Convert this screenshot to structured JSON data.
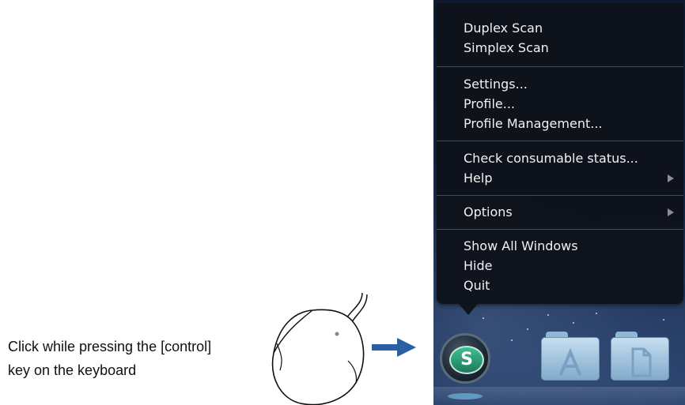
{
  "instruction": {
    "line1": "Click while pressing the [control]",
    "line2": "key on the keyboard"
  },
  "menu": {
    "groups": [
      [
        "Duplex Scan",
        "Simplex Scan"
      ],
      [
        "Settings...",
        "Profile...",
        "Profile Management..."
      ],
      [
        "Check consumable status...",
        "Help"
      ],
      [
        "Options"
      ],
      [
        "Show All Windows",
        "Hide",
        "Quit"
      ]
    ],
    "submenu_items": [
      "Help",
      "Options"
    ]
  },
  "dock": {
    "app_icon": "S",
    "folders": [
      "applications-folder-icon",
      "documents-folder-icon"
    ]
  },
  "colors": {
    "arrow": "#2a5fa3",
    "menu_background": "#0e121a",
    "menu_text": "#f2f2f2"
  }
}
